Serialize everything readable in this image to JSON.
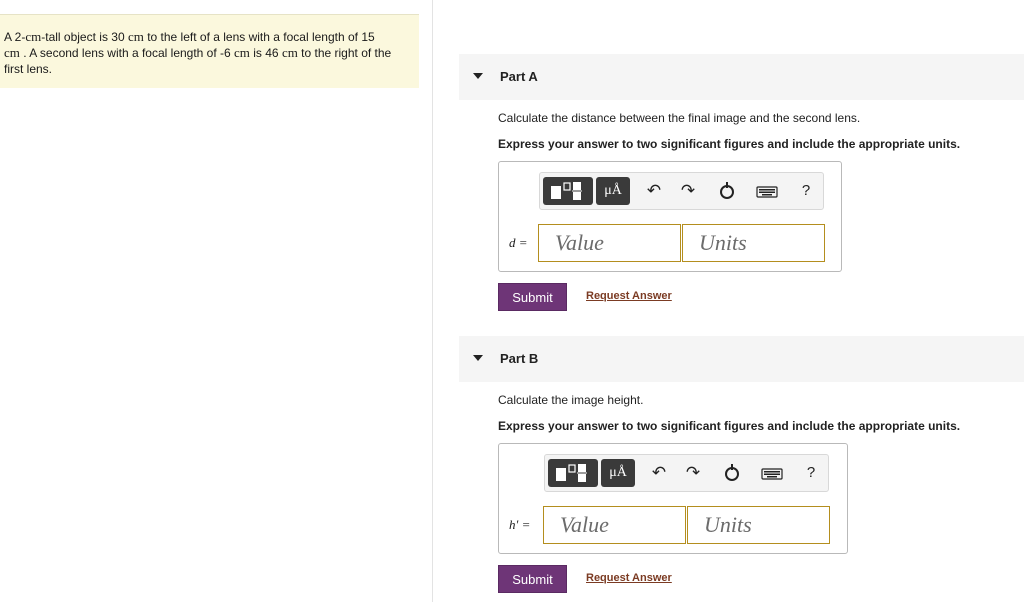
{
  "problem": {
    "t1": "A 2-",
    "u1": "cm",
    "t2": "-tall object is 30 ",
    "u2": "cm",
    "t3": " to the left of a lens with a focal length of 15",
    "u3": "cm",
    "t4": " . A second lens with a focal length of -6 ",
    "u4": "cm",
    "t5": " is 46 ",
    "u5": "cm",
    "t6": " to the right of the first lens."
  },
  "parts": [
    {
      "title": "Part A",
      "question": "Calculate the distance between the final image and the second lens.",
      "instruction": "Express your answer to two significant figures and include the appropriate units.",
      "var_label": "d =",
      "value_placeholder": "Value",
      "units_placeholder": "Units",
      "submit": "Submit",
      "request": "Request Answer"
    },
    {
      "title": "Part B",
      "question": "Calculate the image height.",
      "instruction": "Express your answer to two significant figures and include the appropriate units.",
      "var_label": "h′ =",
      "value_placeholder": "Value",
      "units_placeholder": "Units",
      "submit": "Submit",
      "request": "Request Answer"
    }
  ],
  "toolbar": {
    "units_button": "μÅ",
    "help": "?",
    "icons": [
      "templates-icon",
      "units-icon",
      "undo-icon",
      "redo-icon",
      "reset-icon",
      "keyboard-icon",
      "help-icon"
    ]
  },
  "colors": {
    "submit_bg": "#6e3577",
    "field_border": "#b48e1e",
    "problem_bg": "#fbf8dd",
    "link": "#7b3b23"
  }
}
